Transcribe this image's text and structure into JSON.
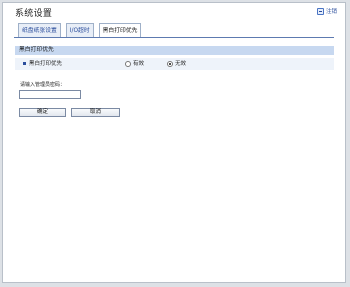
{
  "header": {
    "title": "系统设置",
    "logout_label": "注销"
  },
  "tabs": [
    {
      "label": "纸盘纸张设置",
      "active": false
    },
    {
      "label": "I/O超时",
      "active": false
    },
    {
      "label": "黑白打印优先",
      "active": true
    }
  ],
  "section": {
    "title": "黑白打印优先"
  },
  "setting": {
    "label": "黑白打印优先",
    "options": [
      {
        "label": "有效",
        "checked": false
      },
      {
        "label": "无效",
        "checked": true
      }
    ]
  },
  "password": {
    "label": "请输入管理员密码：",
    "value": ""
  },
  "buttons": {
    "ok": "确定",
    "cancel": "取消"
  },
  "colors": {
    "accent": "#2a4d9c",
    "section_bg": "#c7d8f0",
    "row_bg": "#eef3fa"
  }
}
